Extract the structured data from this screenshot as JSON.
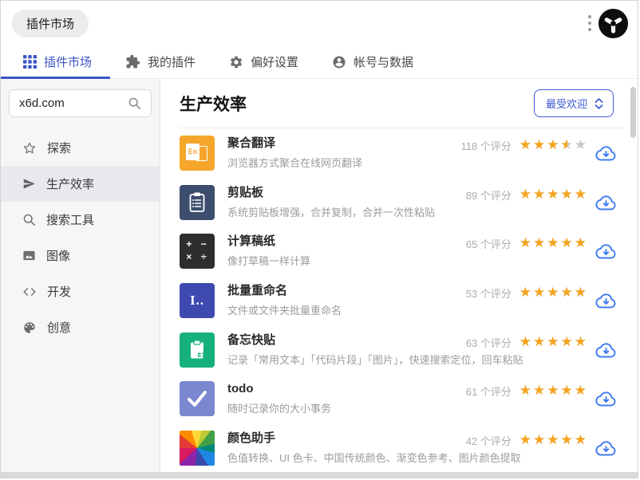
{
  "header": {
    "app_badge": "插件市场"
  },
  "tabs": [
    {
      "label": "插件市场",
      "icon": "grid-icon",
      "active": true
    },
    {
      "label": "我的插件",
      "icon": "puzzle-icon",
      "active": false
    },
    {
      "label": "偏好设置",
      "icon": "gear-icon",
      "active": false
    },
    {
      "label": "帐号与数据",
      "icon": "user-icon",
      "active": false
    }
  ],
  "sidebar": {
    "search_value": "x6d.com",
    "items": [
      {
        "label": "探索",
        "icon": "star-icon",
        "selected": false
      },
      {
        "label": "生产效率",
        "icon": "send-icon",
        "selected": true
      },
      {
        "label": "搜索工具",
        "icon": "search-icon",
        "selected": false
      },
      {
        "label": "图像",
        "icon": "image-icon",
        "selected": false
      },
      {
        "label": "开发",
        "icon": "code-icon",
        "selected": false
      },
      {
        "label": "创意",
        "icon": "palette-icon",
        "selected": false
      }
    ]
  },
  "main": {
    "heading": "生产效率",
    "sort_label": "最受欢迎",
    "plugins": [
      {
        "name": "聚合翻译",
        "desc": "浏览器方式聚合在线网页翻译",
        "ratings": "118 个评分",
        "rating": 3.5,
        "tile_text": "En",
        "tile_color": "#f5a62b",
        "icon": "translate-tile-icon"
      },
      {
        "name": "剪贴板",
        "desc": "系统剪贴板增强，合并复制，合并一次性粘贴",
        "ratings": "89 个评分",
        "rating": 5,
        "tile_color": "#3d4d6e",
        "icon": "clipboard-tile-icon"
      },
      {
        "name": "计算稿纸",
        "desc": "像打草稿一样计算",
        "ratings": "65 个评分",
        "rating": 5,
        "tile_line1": "+ −",
        "tile_line2": "× ÷",
        "tile_color": "#2e2e2e",
        "icon": "calculator-tile-icon"
      },
      {
        "name": "批量重命名",
        "desc": "文件或文件夹批量重命名",
        "ratings": "53 个评分",
        "rating": 5,
        "tile_text": "I..",
        "tile_color": "#3e4ab0",
        "icon": "rename-tile-icon"
      },
      {
        "name": "备忘快贴",
        "desc": "记录「常用文本」「代码片段」「图片」，快速搜索定位，回车粘贴",
        "ratings": "63 个评分",
        "rating": 5,
        "tile_color": "#16b07c",
        "icon": "memo-tile-icon"
      },
      {
        "name": "todo",
        "desc": "随时记录你的大小事务",
        "ratings": "61 个评分",
        "rating": 5,
        "tile_color": "#7b87cf",
        "icon": "todo-check-tile-icon"
      },
      {
        "name": "颜色助手",
        "desc": "色值转换、UI 色卡、中国传统颜色、渐变色参考、图片颜色提取",
        "ratings": "42 个评分",
        "rating": 5,
        "tile_color": "rainbow-wheel",
        "icon": "color-wheel-tile-icon"
      }
    ]
  },
  "colors": {
    "accent_blue": "#3d55c6",
    "sort_blue": "#3a58d6",
    "star_orange": "#f6a41e",
    "star_empty": "#c9c9c9",
    "cloud_blue": "#3e7bf2",
    "sidebar_bg": "#f6f6f7",
    "sidebar_selected_bg": "#e8e8ee",
    "badge_bg": "#ececec"
  }
}
